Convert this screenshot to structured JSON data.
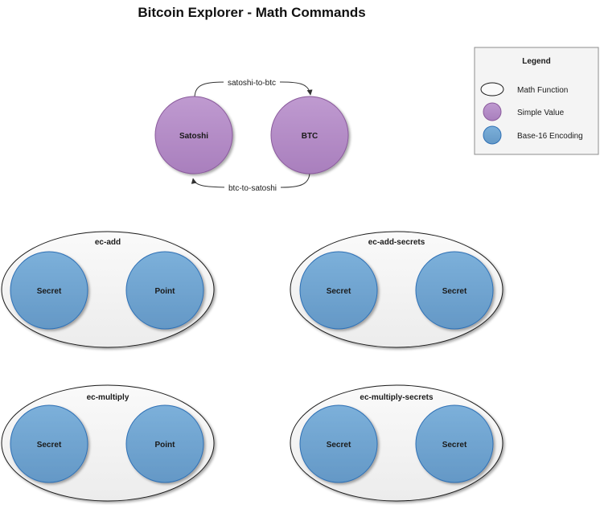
{
  "title": "Bitcoin Explorer - Math Commands",
  "colors": {
    "purple_fill": "#b590c8",
    "purple_stroke": "#8a5a9c",
    "blue_fill": "#72a6d2",
    "blue_stroke": "#2e70b5",
    "group_fill": "#f4f4f4",
    "group_stroke": "#1a1a1a"
  },
  "conversion": {
    "node_a": "Satoshi",
    "node_b": "BTC",
    "top_arrow": "satoshi-to-btc",
    "bottom_arrow": "btc-to-satoshi"
  },
  "groups": [
    {
      "name": "ec-add",
      "left": "Secret",
      "right": "Point"
    },
    {
      "name": "ec-add-secrets",
      "left": "Secret",
      "right": "Secret"
    },
    {
      "name": "ec-multiply",
      "left": "Secret",
      "right": "Point"
    },
    {
      "name": "ec-multiply-secrets",
      "left": "Secret",
      "right": "Secret"
    }
  ],
  "legend": {
    "title": "Legend",
    "items": [
      {
        "label": "Math Function",
        "kind": "function"
      },
      {
        "label": "Simple Value",
        "kind": "simple"
      },
      {
        "label": "Base-16 Encoding",
        "kind": "base16"
      }
    ]
  }
}
